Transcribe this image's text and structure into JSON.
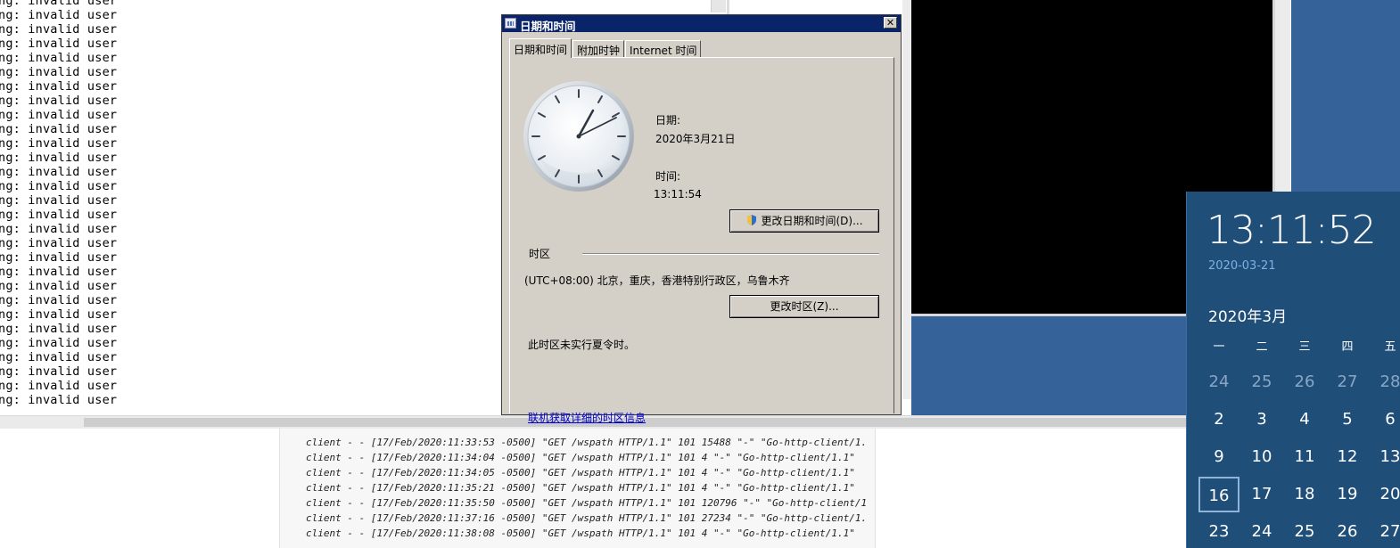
{
  "terminal": {
    "lines": [
      "ng: invalid user",
      "ng: invalid user",
      "ng: invalid user",
      "ng: invalid user",
      "ng: invalid user",
      "ng: invalid user",
      "ng: invalid user",
      "ng: invalid user",
      "ng: invalid user",
      "ng: invalid user",
      "ng: invalid user",
      "ng: invalid user",
      "ng: invalid user",
      "ng: invalid user",
      "ng: invalid user",
      "ng: invalid user",
      "ng: invalid user",
      "ng: invalid user",
      "ng: invalid user",
      "ng: invalid user",
      "ng: invalid user",
      "ng: invalid user",
      "ng: invalid user",
      "ng: invalid user",
      "ng: invalid user",
      "ng: invalid user",
      "ng: invalid user",
      "ng: invalid user",
      "ng: invalid user"
    ]
  },
  "access_log": {
    "lines": [
      "client - - [17/Feb/2020:11:33:53 -0500] \"GET /wspath HTTP/1.1\" 101 15488 \"-\" \"Go-http-client/1.",
      "client - - [17/Feb/2020:11:34:04 -0500] \"GET /wspath HTTP/1.1\" 101 4 \"-\" \"Go-http-client/1.1\"",
      "client - - [17/Feb/2020:11:34:05 -0500] \"GET /wspath HTTP/1.1\" 101 4 \"-\" \"Go-http-client/1.1\"",
      "client - - [17/Feb/2020:11:35:21 -0500] \"GET /wspath HTTP/1.1\" 101 4 \"-\" \"Go-http-client/1.1\"",
      "client - - [17/Feb/2020:11:35:50 -0500] \"GET /wspath HTTP/1.1\" 101 120796 \"-\" \"Go-http-client/1",
      "client - - [17/Feb/2020:11:37:16 -0500] \"GET /wspath HTTP/1.1\" 101 27234 \"-\" \"Go-http-client/1.",
      "client - - [17/Feb/2020:11:38:08 -0500] \"GET /wspath HTTP/1.1\" 101 4 \"-\" \"Go-http-client/1.1\""
    ]
  },
  "dialog": {
    "title": "日期和时间",
    "close_label": "✕",
    "tabs": [
      "日期和时间",
      "附加时钟",
      "Internet 时间"
    ],
    "date_label": "日期:",
    "date_value": "2020年3月21日",
    "time_label": "时间:",
    "time_value": "13:11:54",
    "change_datetime_button": "更改日期和时间(D)...",
    "timezone_group_label": "时区",
    "timezone_value": "(UTC+08:00) 北京，重庆，香港特别行政区，乌鲁木齐",
    "change_timezone_button": "更改时区(Z)...",
    "dst_note": "此时区未实行夏令时。",
    "timezone_info_link": "联机获取详细的时区信息"
  },
  "flyout": {
    "clock": "13:11:52",
    "date": "2020-03-21",
    "month_title": "2020年3月",
    "weekdays": [
      "一",
      "二",
      "三",
      "四",
      "五"
    ],
    "weeks": [
      [
        "24",
        "25",
        "26",
        "27",
        "28"
      ],
      [
        "2",
        "3",
        "4",
        "5",
        "6"
      ],
      [
        "9",
        "10",
        "11",
        "12",
        "13"
      ],
      [
        "16",
        "17",
        "18",
        "19",
        "20"
      ],
      [
        "23",
        "24",
        "25",
        "26",
        "27"
      ]
    ],
    "today": "16",
    "colors": {
      "background": "#1f4e79",
      "accent": "#7fb0e4"
    }
  }
}
